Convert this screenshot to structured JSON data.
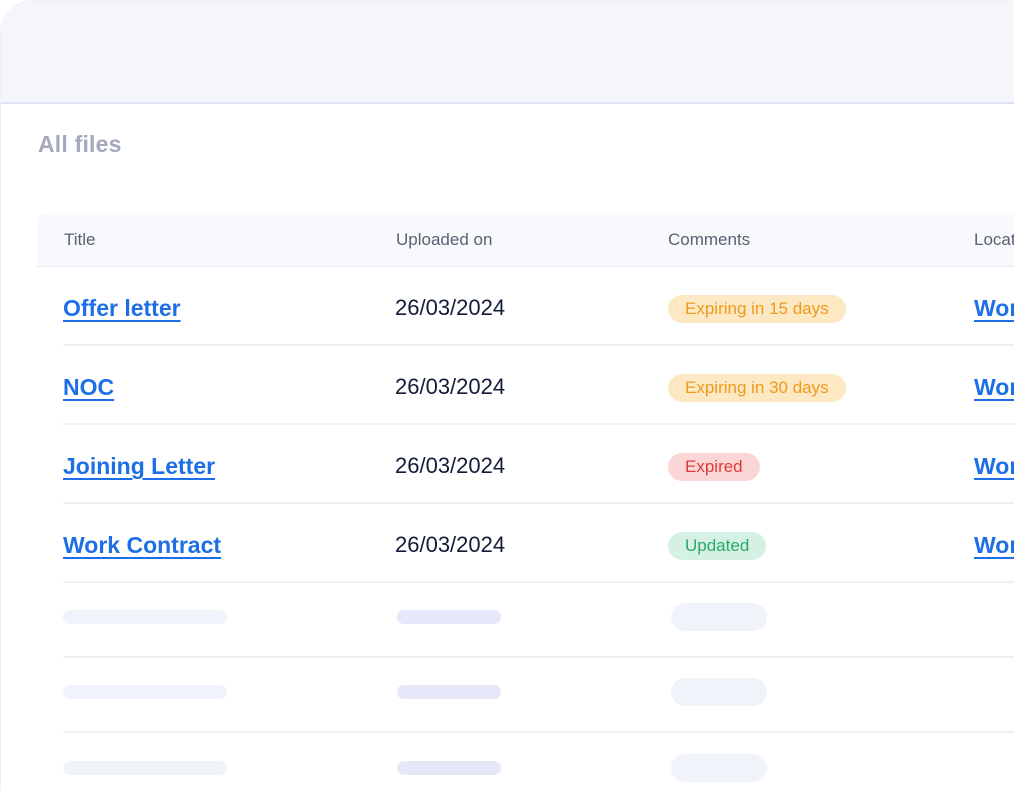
{
  "section": {
    "title": "All files"
  },
  "table": {
    "columns": [
      "Title",
      "Uploaded on",
      "Comments",
      "Locat"
    ],
    "rows": [
      {
        "title": "Offer letter",
        "uploaded_on": "26/03/2024",
        "comment": "Expiring in 15 days",
        "status": "warning",
        "location": "Wor"
      },
      {
        "title": "NOC",
        "uploaded_on": "26/03/2024",
        "comment": "Expiring in 30 days",
        "status": "warning",
        "location": "Wor"
      },
      {
        "title": "Joining Letter",
        "uploaded_on": "26/03/2024",
        "comment": "Expired",
        "status": "danger",
        "location": "Wor"
      },
      {
        "title": "Work Contract",
        "uploaded_on": "26/03/2024",
        "comment": "Updated",
        "status": "success",
        "location": "Wor"
      }
    ],
    "placeholder_rows": 3
  },
  "colors": {
    "link": "#1d6fe6",
    "warning_bg": "#fde8c4",
    "warning_text": "#ef9a1b",
    "danger_bg": "#fbd6d6",
    "danger_text": "#de3b3b",
    "success_bg": "#d5f1e3",
    "success_text": "#2ba86a"
  }
}
